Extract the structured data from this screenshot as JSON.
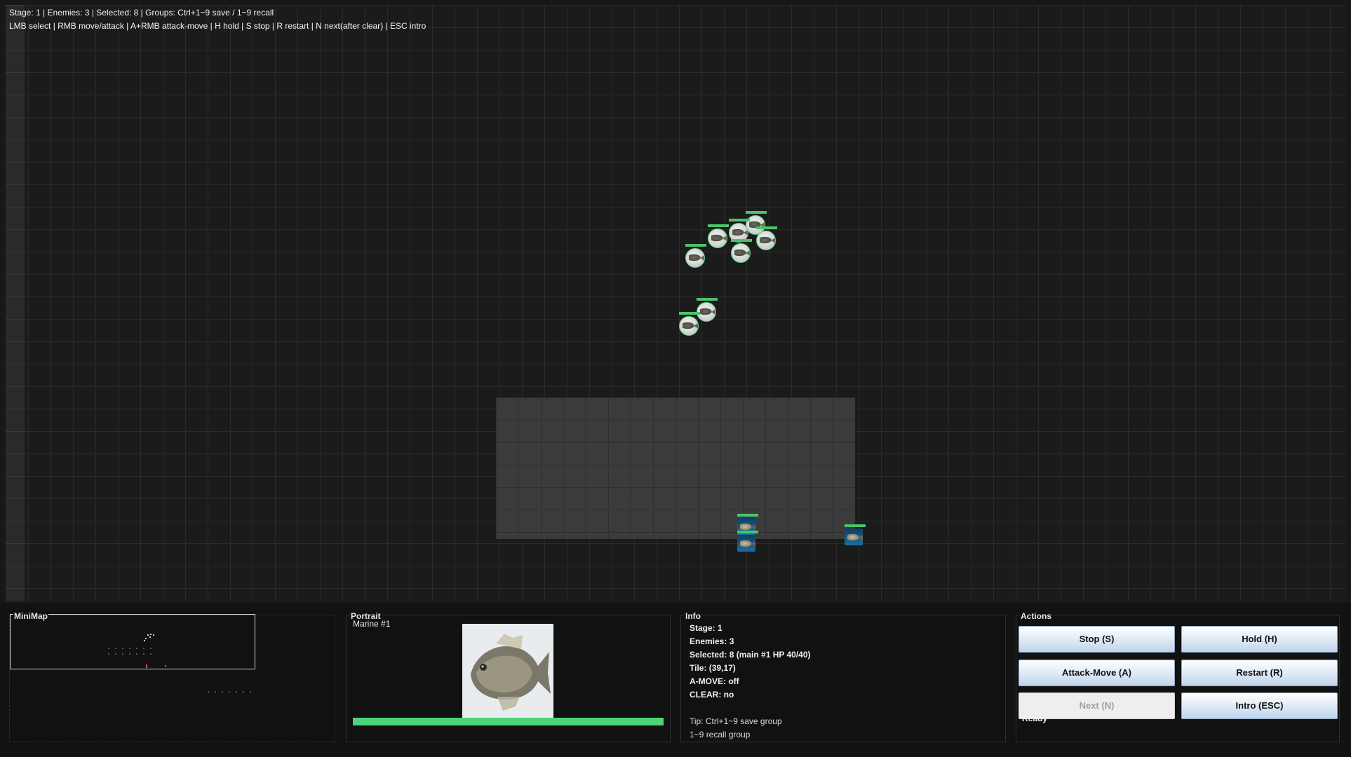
{
  "hud": {
    "line1": "Stage: 1 | Enemies: 3 | Selected: 8 | Groups: Ctrl+1~9 save / 1~9 recall",
    "line2": "LMB select | RMB move/attack | A+RMB attack-move | H hold | S stop | R restart | N next(after clear) | ESC intro"
  },
  "panels": {
    "minimap_title": "MiniMap",
    "portrait_title": "Portrait",
    "info_title": "Info",
    "actions_title": "Actions"
  },
  "portrait": {
    "unit_name": "Marine  #1",
    "hp_fraction": 1.0
  },
  "info": {
    "stage": "Stage: 1",
    "enemies": "Enemies: 3",
    "selected": "Selected: 8 (main #1 HP 40/40)",
    "tile": "Tile: (39,17)",
    "amove": "A-MOVE: off",
    "clear": "CLEAR: no",
    "tip1": "Tip: Ctrl+1~9 save group",
    "tip2": "1~9 recall group"
  },
  "actions": {
    "stop": "Stop (S)",
    "hold": "Hold (H)",
    "attack_move": "Attack-Move (A)",
    "restart": "Restart (R)",
    "next": "Next (N)",
    "intro": "Intro (ESC)",
    "status": "Ready"
  },
  "colors": {
    "ally_hp": "#4cc36b",
    "enemy_body": "#1a6fa0",
    "button_face": "#e3edf8"
  },
  "icons": {
    "unit": "fish-icon",
    "portrait": "fish-portrait-icon"
  }
}
